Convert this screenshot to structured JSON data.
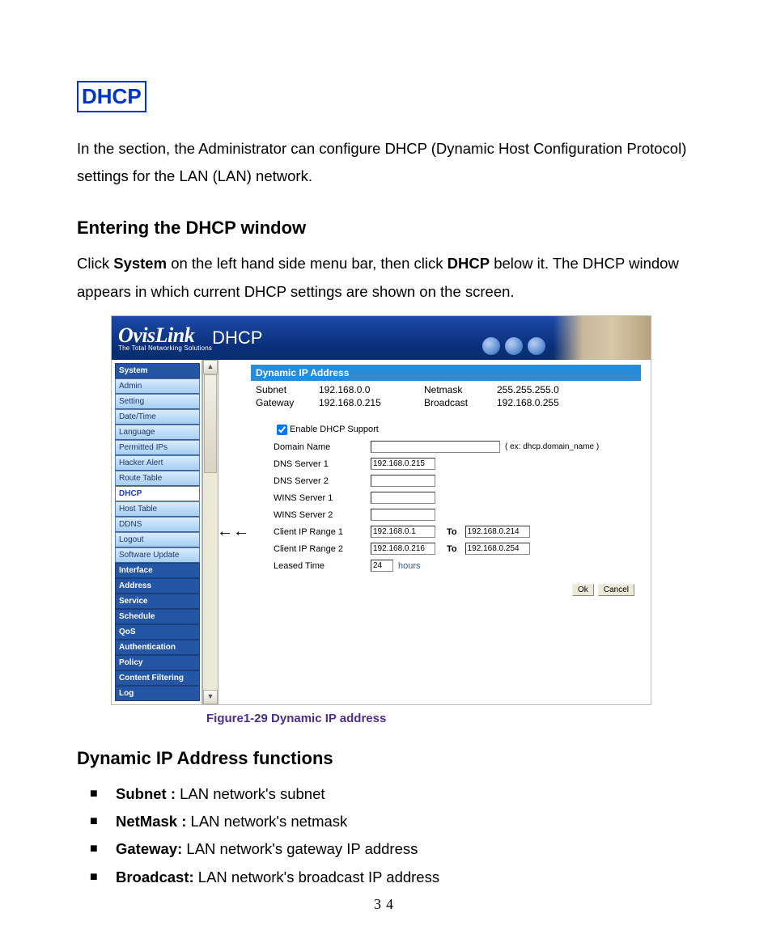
{
  "title": "DHCP",
  "intro": "In the section, the Administrator can configure DHCP (Dynamic Host Configuration Protocol) settings for the LAN (LAN) network.",
  "h_entering": "Entering the DHCP window",
  "entering_text_pre": "Click ",
  "entering_text_b1": "System",
  "entering_text_mid": " on the left hand side menu bar, then click ",
  "entering_text_b2": "DHCP",
  "entering_text_post": " below it. The DHCP window appears in which current DHCP settings are shown on the screen.",
  "caption": "Figure1-29    Dynamic IP address",
  "h_functions": "Dynamic IP Address functions",
  "bullets": [
    {
      "label": "Subnet :",
      "text": " LAN network's subnet"
    },
    {
      "label": "NetMask :",
      "text": " LAN network's netmask"
    },
    {
      "label": "Gateway:",
      "text": " LAN network's gateway IP address"
    },
    {
      "label": "Broadcast:",
      "text": " LAN network's broadcast IP address"
    }
  ],
  "pagenum": "34",
  "screenshot": {
    "brand": "OvisLink",
    "brand_sub": "The Total Networking Solutions",
    "page": "DHCP",
    "pointer": "←←",
    "nav": [
      {
        "label": "System",
        "cls": "header"
      },
      {
        "label": "Admin",
        "cls": "sub"
      },
      {
        "label": "Setting",
        "cls": "sub"
      },
      {
        "label": "Date/Time",
        "cls": "sub"
      },
      {
        "label": "Language",
        "cls": "sub"
      },
      {
        "label": "Permitted IPs",
        "cls": "sub"
      },
      {
        "label": "Hacker Alert",
        "cls": "sub"
      },
      {
        "label": "Route Table",
        "cls": "sub"
      },
      {
        "label": "DHCP",
        "cls": "selected"
      },
      {
        "label": "Host Table",
        "cls": "sub"
      },
      {
        "label": "DDNS",
        "cls": "sub"
      },
      {
        "label": "Logout",
        "cls": "sub"
      },
      {
        "label": "Software Update",
        "cls": "sub"
      },
      {
        "label": "Interface",
        "cls": "header"
      },
      {
        "label": "Address",
        "cls": "header"
      },
      {
        "label": "Service",
        "cls": "header"
      },
      {
        "label": "Schedule",
        "cls": "header"
      },
      {
        "label": "QoS",
        "cls": "header"
      },
      {
        "label": "Authentication",
        "cls": "header"
      },
      {
        "label": "Policy",
        "cls": "header"
      },
      {
        "label": "Content Filtering",
        "cls": "header"
      },
      {
        "label": "Log",
        "cls": "header"
      }
    ],
    "section_title": "Dynamic IP Address",
    "info": {
      "subnet_l": "Subnet",
      "subnet_v": "192.168.0.0",
      "netmask_l": "Netmask",
      "netmask_v": "255.255.255.0",
      "gateway_l": "Gateway",
      "gateway_v": "192.168.0.215",
      "broadcast_l": "Broadcast",
      "broadcast_v": "192.168.0.255"
    },
    "enable_label": "Enable DHCP Support",
    "form": {
      "domain_l": "Domain Name",
      "domain_v": "",
      "domain_hint": "( ex: dhcp.domain_name )",
      "dns1_l": "DNS Server 1",
      "dns1_v": "192.168.0.215",
      "dns2_l": "DNS Server 2",
      "dns2_v": "",
      "wins1_l": "WINS Server 1",
      "wins1_v": "",
      "wins2_l": "WINS Server 2",
      "wins2_v": "",
      "range1_l": "Client IP Range 1",
      "range1_from": "192.168.0.1",
      "to": "To",
      "range1_to": "192.168.0.214",
      "range2_l": "Client IP Range 2",
      "range2_from": "192.168.0.216",
      "range2_to": "192.168.0.254",
      "leased_l": "Leased Time",
      "leased_v": "24",
      "leased_unit": "hours"
    },
    "buttons": {
      "ok": "Ok",
      "cancel": "Cancel"
    }
  }
}
